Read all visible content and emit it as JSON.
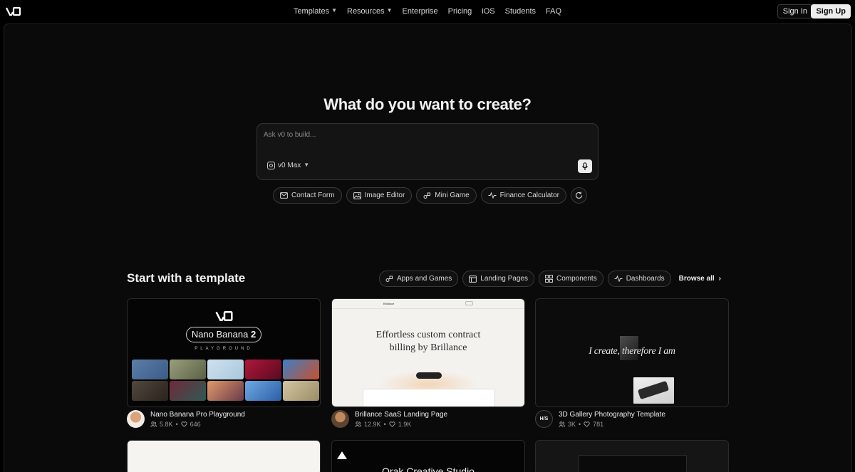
{
  "nav": {
    "items": [
      {
        "label": "Templates",
        "dropdown": true
      },
      {
        "label": "Resources",
        "dropdown": true
      },
      {
        "label": "Enterprise",
        "dropdown": false
      },
      {
        "label": "Pricing",
        "dropdown": false
      },
      {
        "label": "iOS",
        "dropdown": false
      },
      {
        "label": "Students",
        "dropdown": false
      },
      {
        "label": "FAQ",
        "dropdown": false
      }
    ],
    "sign_in": "Sign In",
    "sign_up": "Sign Up"
  },
  "hero": {
    "title": "What do you want to create?",
    "placeholder": "Ask v0 to build...",
    "model": "v0 Max"
  },
  "suggestions": [
    {
      "label": "Contact Form",
      "icon": "mail-icon"
    },
    {
      "label": "Image Editor",
      "icon": "image-icon"
    },
    {
      "label": "Mini Game",
      "icon": "game-icon"
    },
    {
      "label": "Finance Calculator",
      "icon": "pulse-icon"
    }
  ],
  "templates_section": {
    "title": "Start with a template",
    "filters": [
      {
        "label": "Apps and Games",
        "icon": "game-icon"
      },
      {
        "label": "Landing Pages",
        "icon": "layout-icon"
      },
      {
        "label": "Components",
        "icon": "grid-icon"
      },
      {
        "label": "Dashboards",
        "icon": "pulse-icon"
      }
    ],
    "browse_all": "Browse all"
  },
  "cards": [
    {
      "title": "Nano Banana Pro Playground",
      "users": "5.8K",
      "likes": "646",
      "preview": {
        "pill_text": "Nano Banana",
        "pill_num": "2",
        "sub": "PLAYGROUND"
      }
    },
    {
      "title": "Brillance SaaS Landing Page",
      "users": "12.9K",
      "likes": "1.9K",
      "preview": {
        "brand": "Brillance",
        "headline_1": "Effortless custom contract",
        "headline_2": "billing by Brillance"
      }
    },
    {
      "title": "3D Gallery Photography Template",
      "users": "3K",
      "likes": "781",
      "author_logo": "H/S",
      "preview": {
        "headline": "I create, therefore I am"
      }
    }
  ],
  "peek_cards": [
    {
      "text": ""
    },
    {
      "text": "Orak Creative Studio"
    },
    {
      "text": ""
    }
  ],
  "colors": {
    "background": "#000000",
    "panel": "#0a0a0a",
    "border": "#333333",
    "text": "#ededed"
  }
}
